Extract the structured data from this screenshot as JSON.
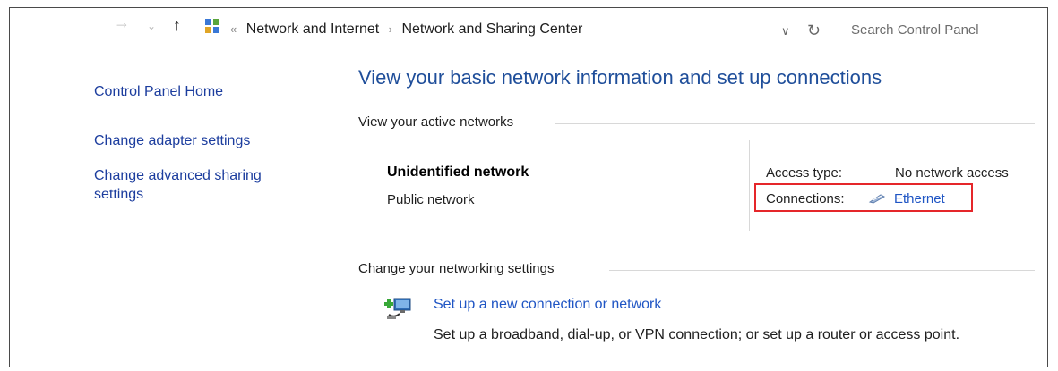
{
  "address_bar": {
    "overflow": "«",
    "breadcrumbs": [
      "Network and Internet",
      "Network and Sharing Center"
    ],
    "separator": "›",
    "search_placeholder": "Search Control Panel"
  },
  "sidebar": {
    "items": [
      {
        "label": "Control Panel Home"
      },
      {
        "label": "Change adapter settings"
      },
      {
        "label": "Change advanced sharing settings"
      }
    ]
  },
  "main": {
    "title": "View your basic network information and set up connections",
    "active_networks": {
      "heading": "View your active networks",
      "network_name": "Unidentified network",
      "network_type": "Public network",
      "access_type_label": "Access type:",
      "access_type_value": "No network access",
      "connections_label": "Connections:",
      "connection_name": "Ethernet"
    },
    "networking_settings": {
      "heading": "Change your networking settings",
      "task_link": "Set up a new connection or network",
      "task_description": "Set up a broadband, dial-up, or VPN connection; or set up a router or access point."
    }
  },
  "colors": {
    "link": "#1f55c4",
    "title": "#1f4e9a",
    "highlight": "#e5262a"
  }
}
